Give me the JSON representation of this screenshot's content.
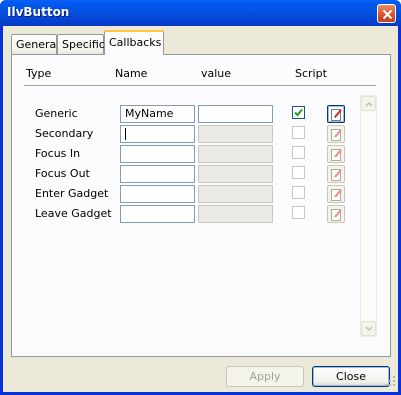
{
  "window": {
    "title": "IlvButton"
  },
  "tabs": [
    {
      "label": "General",
      "active": false
    },
    {
      "label": "Specific",
      "active": false
    },
    {
      "label": "Callbacks",
      "active": true
    }
  ],
  "columns": {
    "type": "Type",
    "name": "Name",
    "value": "value",
    "script": "Script"
  },
  "rows": [
    {
      "type": "Generic",
      "name": "MyName",
      "value": "",
      "checked": true,
      "enabled": true
    },
    {
      "type": "Secondary",
      "name": "",
      "value": "",
      "checked": false,
      "enabled": false
    },
    {
      "type": "Focus In",
      "name": "",
      "value": "",
      "checked": false,
      "enabled": false
    },
    {
      "type": "Focus Out",
      "name": "",
      "value": "",
      "checked": false,
      "enabled": false
    },
    {
      "type": "Enter Gadget",
      "name": "",
      "value": "",
      "checked": false,
      "enabled": false
    },
    {
      "type": "Leave Gadget",
      "name": "",
      "value": "",
      "checked": false,
      "enabled": false
    }
  ],
  "buttons": {
    "apply": "Apply",
    "close": "Close"
  },
  "icons": {
    "close": "close-icon",
    "script_edit": "pencil-edit-icon"
  },
  "colors": {
    "titlebar": "#0054e3",
    "check": "#21a121",
    "tab_highlight": "#ffc73c"
  }
}
